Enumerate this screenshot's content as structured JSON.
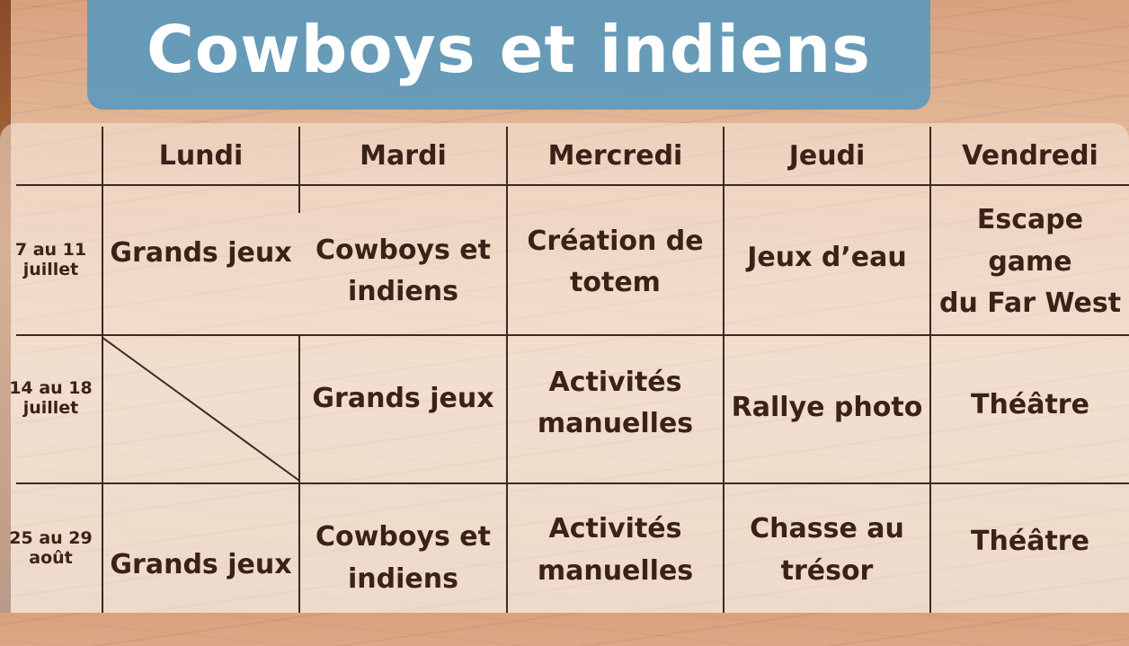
{
  "title": "Cowboys et indiens",
  "days": [
    "Lundi",
    "Mardi",
    "Mercredi",
    "Jeudi",
    "Vendredi"
  ],
  "weeks": [
    {
      "line1": "7 au 11",
      "line2": "juillet",
      "activities": [
        {
          "line1": "Grands jeux",
          "line2": ""
        },
        {
          "line1": "Cowboys et",
          "line2": "indiens"
        },
        {
          "line1": "Création de",
          "line2": "totem"
        },
        {
          "line1": "Jeux d’eau",
          "line2": ""
        },
        {
          "line1": "Escape game",
          "line2": "du Far West"
        }
      ]
    },
    {
      "line1": "14 au 18",
      "line2": "juillet",
      "activities": [
        {
          "line1": "",
          "line2": ""
        },
        {
          "line1": "Grands jeux",
          "line2": ""
        },
        {
          "line1": "Activités",
          "line2": "manuelles"
        },
        {
          "line1": "Rallye photo",
          "line2": ""
        },
        {
          "line1": "Théâtre",
          "line2": ""
        }
      ]
    },
    {
      "line1": "25 au 29",
      "line2": "août",
      "activities": [
        {
          "line1": "Grands jeux",
          "line2": ""
        },
        {
          "line1": "Cowboys et",
          "line2": "indiens"
        },
        {
          "line1": "Activités",
          "line2": "manuelles"
        },
        {
          "line1": "Chasse au",
          "line2": "trésor"
        },
        {
          "line1": "Théâtre",
          "line2": ""
        }
      ]
    }
  ]
}
